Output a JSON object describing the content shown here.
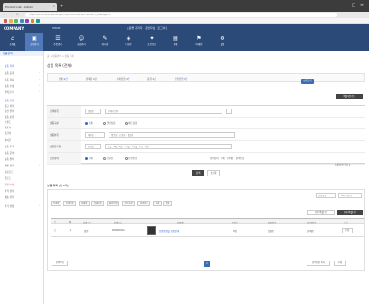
{
  "browser": {
    "tab_title": "Product List - Admin",
    "tab_close": "×",
    "newtab": "+",
    "min": "–",
    "max": "□",
    "close": "×",
    "back": "←",
    "forward": "→",
    "reload": "↻",
    "address": "https://admin.example-shop.com/product/list?tab=product_list&page=1"
  },
  "topbar": {
    "logo": "COMPANY",
    "shop_name": "SHOP",
    "info": "쇼핑몰 관리자 · 운영자님 · 로그아웃"
  },
  "menu": [
    {
      "icon": "⌂",
      "label": "쇼핑몰"
    },
    {
      "icon": "▣",
      "label": "상품관리"
    },
    {
      "icon": "☰",
      "label": "주문관리"
    },
    {
      "icon": "☺",
      "label": "회원관리"
    },
    {
      "icon": "✎",
      "label": "게시판"
    },
    {
      "icon": "◈",
      "label": "디자인"
    },
    {
      "icon": "✦",
      "label": "프로모션"
    },
    {
      "icon": "▤",
      "label": "통계"
    },
    {
      "icon": "⚑",
      "label": "마케팅"
    },
    {
      "icon": "⚙",
      "label": "설정"
    }
  ],
  "sidebar": {
    "header": "상품관리",
    "items": [
      "상품 목록",
      "상품 등록",
      "상품 복사",
      "상품 수정",
      "카테고리",
      "상품 진열",
      "재고 관리",
      "옵션 관리",
      "상품 분류",
      "브랜드",
      "제조사",
      "공급사",
      "아이콘",
      "상품 후기",
      "상품 문의",
      "상품 필터",
      "엑셀 관리",
      "다운로드",
      "업로드",
      "일괄 수정",
      "가격 관리",
      "배송 관리",
      "추가 설정"
    ],
    "arrow": "›"
  },
  "main": {
    "breadcrumb": "홈 > 상품관리 > 상품 목록",
    "title": "상품 목록 (전체)",
    "summary": [
      {
        "label": "전체",
        "count": "0건"
      },
      {
        "label": "판매중",
        "count": "0건"
      },
      {
        "label": "판매안함",
        "count": "0건"
      },
      {
        "label": "품절",
        "count": "0건"
      },
      {
        "label": "진열안함",
        "count": "0건"
      }
    ],
    "register_button": "상품등록",
    "excel_button": "엑셀다운로드",
    "filters": [
      {
        "label": "검색분류",
        "value": "상품명",
        "extra": "검색어 입력"
      },
      {
        "label": "상품구분",
        "options": [
          "전체",
          "일반상품",
          "세트상품"
        ]
      },
      {
        "label": "상품분류",
        "value": "대분류",
        "extra": "중분류 · 소분류 · 세분류"
      },
      {
        "label": "상품등록일",
        "value": "등록일",
        "extra": "오늘 · 3일 · 7일 · 1개월 · 3개월 · 1년 · 전체"
      },
      {
        "label": "진열상태",
        "options": [
          "전체",
          "진열함",
          "진열안함"
        ],
        "extra": "판매상태 · 전체 · 판매함 · 판매안함"
      },
      {
        "label": "옵션사용",
        "options": [
          "전체",
          "사용함",
          "사용안함"
        ]
      }
    ],
    "more_link": "상세검색 열기 ▾",
    "search_button": "검색",
    "reset_button": "초기화",
    "result": {
      "title": "상품 목록 [총 0개]",
      "sort_label": "신상품순",
      "per_page": "10개씩보기",
      "chips": [
        "진열함",
        "진열안함",
        "판매함",
        "판매안함",
        "메인진열",
        "분류수정",
        "상품복사",
        "삭제",
        "엑셀"
      ],
      "export_buttons": [
        "선택 엑셀다운",
        "전체 엑셀다운"
      ],
      "headers": [
        "□",
        "No",
        "상품구분",
        "상품코드",
        "",
        "상품명",
        "판매가",
        "진열상태",
        "판매상태",
        "관리"
      ],
      "row": [
        "□",
        "1",
        "일반",
        "P0000000A",
        "",
        "상품명 샘플 상품 상세",
        "0원",
        "진열함",
        "판매함",
        "수정"
      ],
      "bottom_buttons": [
        "선택삭제",
        "선택상품 복사",
        "수정"
      ]
    },
    "page": "1"
  }
}
